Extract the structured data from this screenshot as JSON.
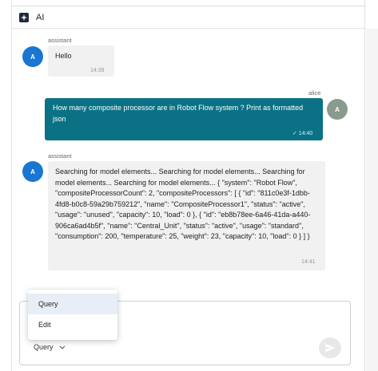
{
  "header": {
    "title": "AI"
  },
  "messages": [
    {
      "sender": "assistant",
      "avatar": "A",
      "text": "Hello",
      "time": "14:39"
    },
    {
      "sender": "alice",
      "avatar": "A",
      "text": "How many composite processor are in Robot Flow system ? Print as formatted json",
      "time": "✓ 14:40"
    },
    {
      "sender": "assistant",
      "avatar": "A",
      "text": "Searching for model elements... Searching for model elements... Searching for model elements... Searching for model elements... { \"system\": \"Robot Flow\", \"compositeProcessorCount\": 2, \"compositeProcessors\": [ { \"id\": \"811c0e3f-1dbb-4fd8-b0c8-59a29b759212\", \"name\": \"CompositeProcessor1\", \"status\": \"active\", \"usage\": \"unused\", \"capacity\": 10, \"load\": 0 }, { \"id\": \"eb8b78ee-6a46-41da-a440-906ca6ad4b5f\", \"name\": \"Central_Unit\", \"status\": \"active\", \"usage\": \"standard\", \"consumption\": 200, \"temperature\": 25, \"weight\": 23, \"capacity\": 10, \"load\": 0 } ] }",
      "time": "14:41"
    }
  ],
  "composer": {
    "mode_value": "Query",
    "menu_options": [
      "Query",
      "Edit"
    ]
  },
  "icons": {
    "ai": "sparkle-icon",
    "send": "send-icon",
    "dropdown": "chevron-down-icon"
  },
  "colors": {
    "assistant_avatar": "#1976d2",
    "user_avatar": "#8a9a8e",
    "user_bubble": "#0b7285",
    "assistant_bubble": "#f1f1f1"
  }
}
